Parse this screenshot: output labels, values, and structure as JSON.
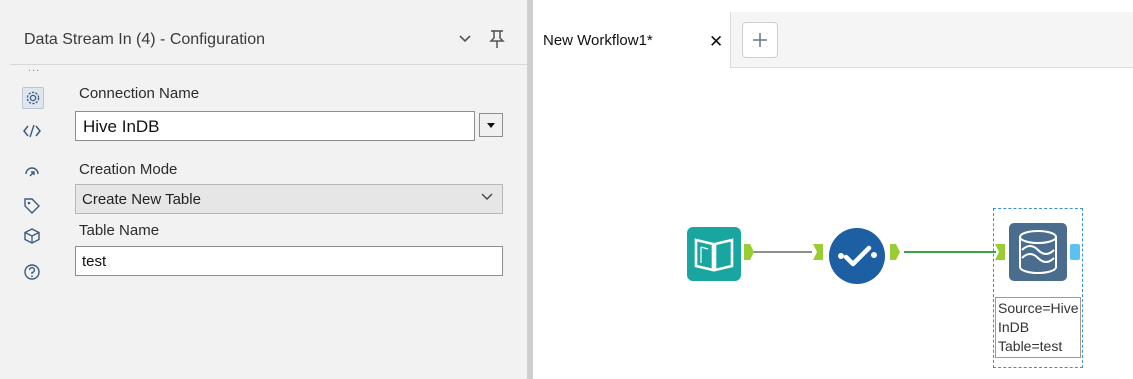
{
  "config_panel": {
    "title": "Data Stream In (4) - Configuration",
    "overflow_dots": "...",
    "connection_name": {
      "label": "Connection Name",
      "value": "Hive InDB"
    },
    "creation_mode": {
      "label": "Creation Mode",
      "value": "Create New Table"
    },
    "table_name": {
      "label": "Table Name",
      "value": "test"
    },
    "side_icons": [
      "gear-icon",
      "code-icon",
      "arrow-circle-icon",
      "tag-icon",
      "cube-icon",
      "help-icon"
    ]
  },
  "workflow": {
    "tab_label": "New Workflow1*",
    "tab_close": "✕",
    "new_tab": "+",
    "annotation": [
      "Source=Hive",
      "InDB",
      "Table=test"
    ]
  },
  "colors": {
    "input_tool": "#1aa6a0",
    "browse_tool": "#1c5fa3",
    "stream_tool": "#4a6d8e",
    "anchor_green": "#9acd32",
    "anchor_blue": "#5bc2f0",
    "connection_green": "#3aa04a"
  }
}
